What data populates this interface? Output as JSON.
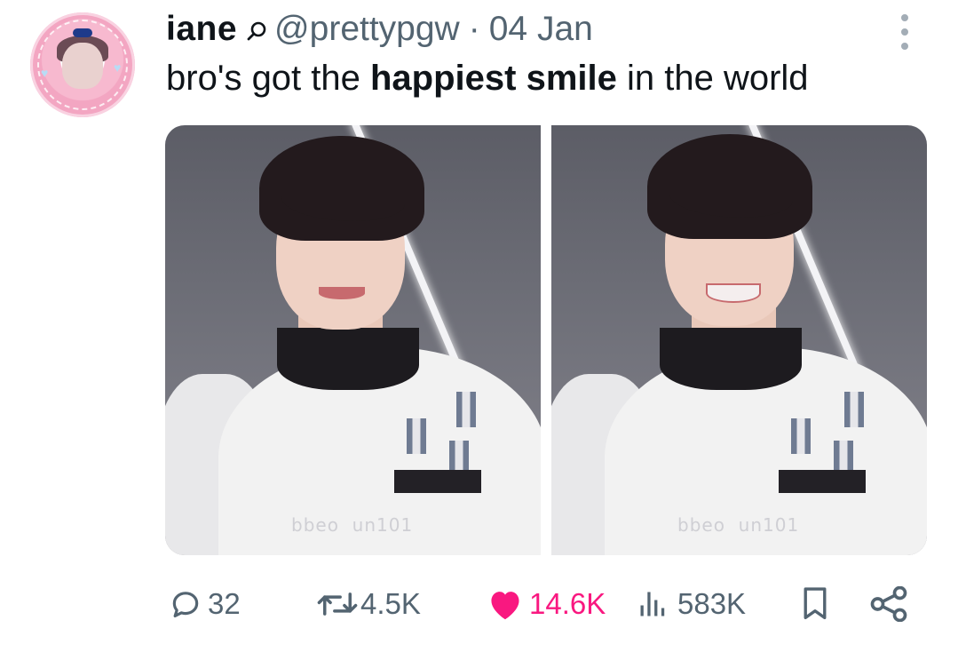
{
  "author": {
    "name": "iane",
    "handle": "@prettypgw",
    "separator": "·",
    "date": "04 Jan"
  },
  "tweet": {
    "text_before": "bro's got the ",
    "text_bold": "happiest smile",
    "text_after": " in the world"
  },
  "media": {
    "images": [
      {
        "watermark": "bbeo  un101",
        "description_icon": "photo"
      },
      {
        "watermark": "bbeo  un101",
        "description_icon": "photo"
      }
    ]
  },
  "actions": {
    "replies": "32",
    "reposts": "4.5K",
    "likes": "14.6K",
    "views": "583K"
  },
  "colors": {
    "text": "#0f1419",
    "muted": "#536471",
    "like": "#f91880",
    "menu_dots": "#a3adb6"
  },
  "icons": [
    "search-icon",
    "more-icon",
    "reply-icon",
    "repost-icon",
    "heart-icon",
    "views-icon",
    "bookmark-icon",
    "share-icon"
  ]
}
